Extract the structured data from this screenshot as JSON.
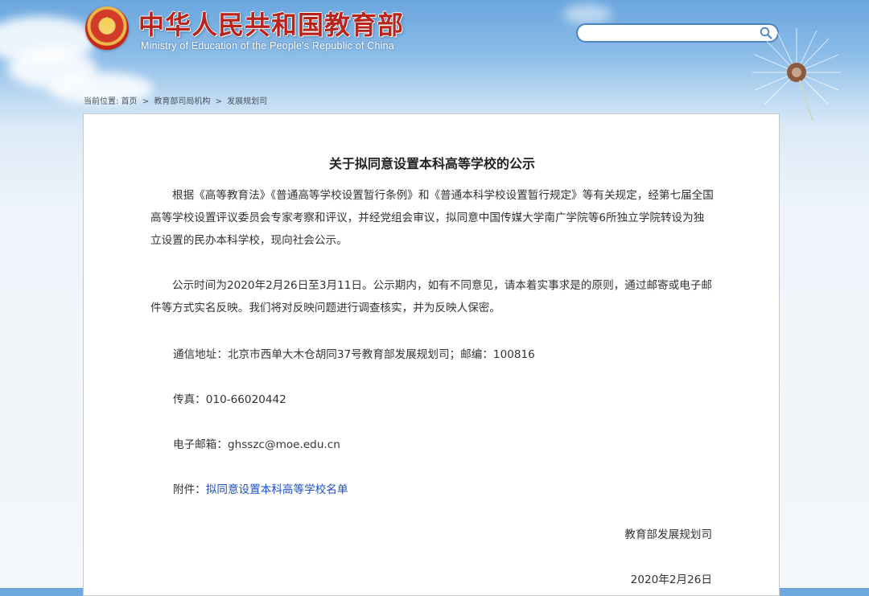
{
  "header": {
    "title": "中华人民共和国教育部",
    "subtitle": "Ministry of Education of the People's Republic of China",
    "search_placeholder": ""
  },
  "breadcrumb": {
    "label": "当前位置:",
    "items": [
      "首页",
      "教育部司局机构",
      "发展规划司"
    ],
    "separator": ">"
  },
  "article": {
    "title": "关于拟同意设置本科高等学校的公示",
    "paragraph1": "根据《高等教育法》《普通高等学校设置暂行条例》和《普通本科学校设置暂行规定》等有关规定，经第七届全国高等学校设置评议委员会专家考察和评议，并经党组会审议，拟同意中国传媒大学南广学院等6所独立学院转设为独立设置的民办本科学校，现向社会公示。",
    "paragraph2": "公示时间为2020年2月26日至3月11日。公示期内，如有不同意见，请本着实事求是的原则，通过邮寄或电子邮件等方式实名反映。我们将对反映问题进行调查核实，并为反映人保密。",
    "address": "通信地址：北京市西单大木仓胡同37号教育部发展规划司；邮编：100816",
    "fax": "传真：010-66020442",
    "email": "电子邮箱：ghsszc@moe.edu.cn",
    "attachment_label": "附件：",
    "attachment_link": "拟同意设置本科高等学校名单",
    "signature": "教育部发展规划司",
    "date": "2020年2月26日"
  },
  "colors": {
    "title_red": "#b8241c",
    "link_blue": "#1f4fbf",
    "search_border": "#4a83c4"
  },
  "icons": [
    "national-emblem-icon",
    "search-icon",
    "dandelion-decoration"
  ]
}
